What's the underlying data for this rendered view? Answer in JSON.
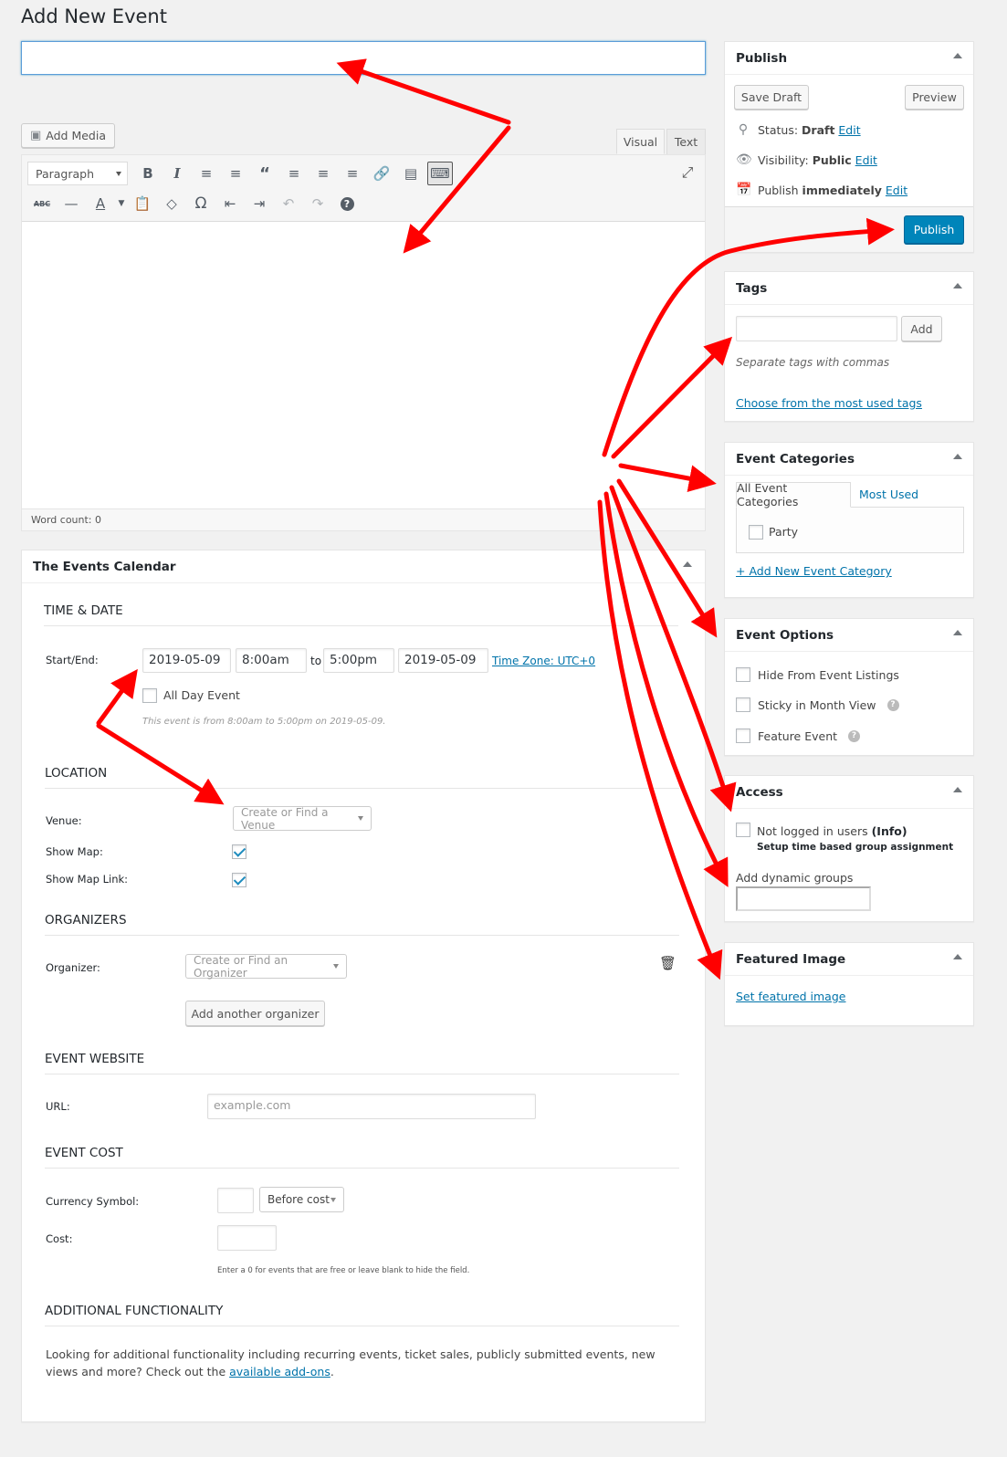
{
  "page": {
    "title": "Add New Event"
  },
  "post_title": {
    "value": "",
    "placeholder": ""
  },
  "editor": {
    "add_media_label": "Add Media",
    "tabs": [
      {
        "label": "Visual",
        "active": true
      },
      {
        "label": "Text",
        "active": false
      }
    ],
    "format_select": "Paragraph",
    "toolbar_row1": [
      "bold",
      "italic",
      "bulleted-list",
      "numbered-list",
      "blockquote",
      "align-left",
      "align-center",
      "align-right",
      "insert-link",
      "read-more",
      "toolbar-toggle"
    ],
    "toolbar_row2": [
      "strikethrough",
      "horizontal-line",
      "text-color",
      "paste-as-text",
      "clear-formatting",
      "special-character",
      "decrease-indent",
      "increase-indent",
      "undo",
      "redo",
      "keyboard-shortcuts"
    ],
    "word_count": "Word count: 0"
  },
  "events_calendar": {
    "title": "The Events Calendar",
    "time_date": {
      "heading": "TIME & DATE",
      "start_end_label": "Start/End:",
      "start_date": "2019-05-09",
      "start_time": "8:00am",
      "to_label": "to",
      "end_time": "5:00pm",
      "end_date": "2019-05-09",
      "timezone_link": "Time Zone: UTC+0",
      "all_day_label": "All Day Event",
      "all_day_checked": false,
      "summary": "This event is from 8:00am to 5:00pm on 2019-05-09."
    },
    "location": {
      "heading": "LOCATION",
      "venue_label": "Venue:",
      "venue_placeholder": "Create or Find a Venue",
      "show_map_label": "Show Map:",
      "show_map_checked": true,
      "show_map_link_label": "Show Map Link:",
      "show_map_link_checked": true
    },
    "organizers": {
      "heading": "ORGANIZERS",
      "organizer_label": "Organizer:",
      "organizer_placeholder": "Create or Find an Organizer",
      "add_another_label": "Add another organizer"
    },
    "website": {
      "heading": "EVENT WEBSITE",
      "url_label": "URL:",
      "url_placeholder": "example.com"
    },
    "cost": {
      "heading": "EVENT COST",
      "currency_label": "Currency Symbol:",
      "currency_value": "",
      "position_select": "Before cost",
      "cost_label": "Cost:",
      "cost_value": "",
      "hint": "Enter a 0 for events that are free or leave blank to hide the field."
    },
    "additional": {
      "heading": "ADDITIONAL FUNCTIONALITY",
      "text_before": "Looking for additional functionality including recurring events, ticket sales, publicly submitted events, new views and more? Check out the ",
      "link": "available add-ons",
      "text_after": "."
    }
  },
  "publish": {
    "title": "Publish",
    "save_draft": "Save Draft",
    "preview": "Preview",
    "status_label": "Status:",
    "status_value": "Draft",
    "visibility_label": "Visibility:",
    "visibility_value": "Public",
    "schedule_label": "Publish",
    "schedule_value": "immediately",
    "edit_link": "Edit",
    "publish_button": "Publish",
    "accent": "#0085ba"
  },
  "tags": {
    "title": "Tags",
    "input_value": "",
    "add_button": "Add",
    "hint": "Separate tags with commas",
    "choose_link": "Choose from the most used tags"
  },
  "event_categories": {
    "title": "Event Categories",
    "tabs": [
      {
        "label": "All Event Categories",
        "active": true
      },
      {
        "label": "Most Used",
        "active": false
      }
    ],
    "items": [
      {
        "label": "Party",
        "checked": false
      }
    ],
    "add_link": "+ Add New Event Category"
  },
  "event_options": {
    "title": "Event Options",
    "items": [
      {
        "label": "Hide From Event Listings",
        "checked": false,
        "help": false
      },
      {
        "label": "Sticky in Month View",
        "checked": false,
        "help": true
      },
      {
        "label": "Feature Event",
        "checked": false,
        "help": true
      }
    ]
  },
  "access": {
    "title": "Access",
    "not_logged_label": "Not logged in users",
    "info_label": "(Info)",
    "not_logged_checked": false,
    "setup_label": "Setup time based group assignment",
    "dynamic_groups_label": "Add dynamic groups",
    "dynamic_groups_value": ""
  },
  "featured_image": {
    "title": "Featured Image",
    "set_link": "Set featured image"
  },
  "annotation_color": "#ff0000"
}
